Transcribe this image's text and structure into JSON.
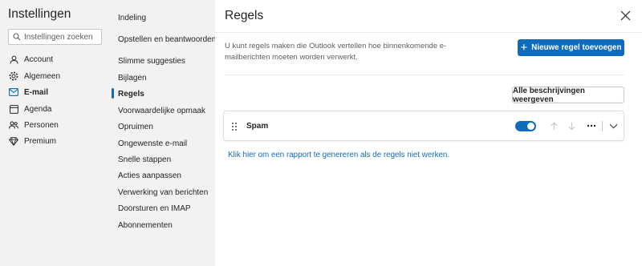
{
  "app_title": "Instellingen",
  "search": {
    "placeholder": "Instellingen zoeken"
  },
  "categories": [
    {
      "label": "Account",
      "icon": "person-icon"
    },
    {
      "label": "Algemeen",
      "icon": "gear-icon"
    },
    {
      "label": "E-mail",
      "icon": "mail-icon",
      "active": true
    },
    {
      "label": "Agenda",
      "icon": "calendar-icon"
    },
    {
      "label": "Personen",
      "icon": "people-icon"
    },
    {
      "label": "Premium",
      "icon": "diamond-icon"
    }
  ],
  "subnav": {
    "items": [
      "Indeling",
      "Opstellen en beantwoorden",
      "Slimme suggesties",
      "Bijlagen",
      "Regels",
      "Voorwaardelijke opmaak",
      "Opruimen",
      "Ongewenste e-mail",
      "Snelle stappen",
      "Acties aanpassen",
      "Verwerking van berichten",
      "Doorsturen en IMAP",
      "Abonnementen"
    ],
    "active_index": 4
  },
  "main": {
    "title": "Regels",
    "description": "U kunt regels maken die Outlook vertellen hoe binnenkomende e-mailberichten moeten worden verwerkt.",
    "new_rule_label": "Nieuwe regel toevoegen",
    "show_all_label": "Alle beschrijvingen weergeven",
    "rules": [
      {
        "name": "Spam",
        "enabled": true
      }
    ],
    "report_link": "Klik hier om een rapport te genereren als de regels niet werken."
  },
  "colors": {
    "accent": "#0f6cbd",
    "sidebar_bg": "#f3f2f1",
    "text": "#242424"
  }
}
